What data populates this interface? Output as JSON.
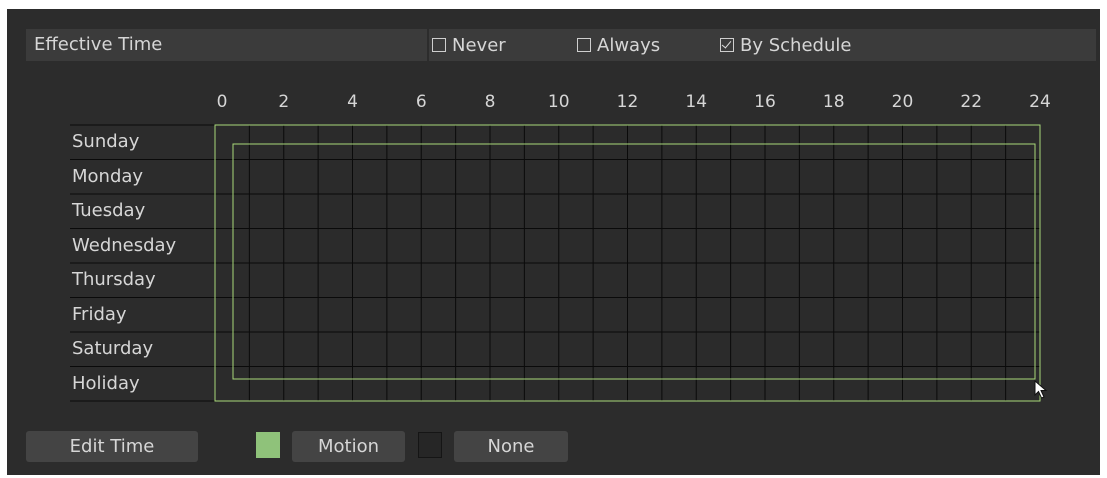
{
  "header": {
    "title": "Effective Time",
    "options": [
      {
        "label": "Never",
        "checked": false
      },
      {
        "label": "Always",
        "checked": false
      },
      {
        "label": "By Schedule",
        "checked": true
      }
    ]
  },
  "schedule": {
    "hour_labels": [
      "0",
      "2",
      "4",
      "6",
      "8",
      "10",
      "12",
      "14",
      "16",
      "18",
      "20",
      "22",
      "24"
    ],
    "days": [
      "Sunday",
      "Monday",
      "Tuesday",
      "Wednesday",
      "Thursday",
      "Friday",
      "Saturday",
      "Holiday"
    ]
  },
  "footer": {
    "edit_time_label": "Edit Time",
    "motion_label": "Motion",
    "none_label": "None"
  },
  "colors": {
    "panel_bg": "#2c2c2c",
    "header_bg": "#3b3b3b",
    "button_bg": "#444444",
    "text": "#d6d6d6",
    "motion_green": "#8fc27a",
    "selection_outline": "#a8d87a",
    "grid_line": "#0a0a0a"
  },
  "icons": {
    "cursor": "mouse-pointer-icon",
    "checkbox_checked": "checkmark-icon"
  }
}
